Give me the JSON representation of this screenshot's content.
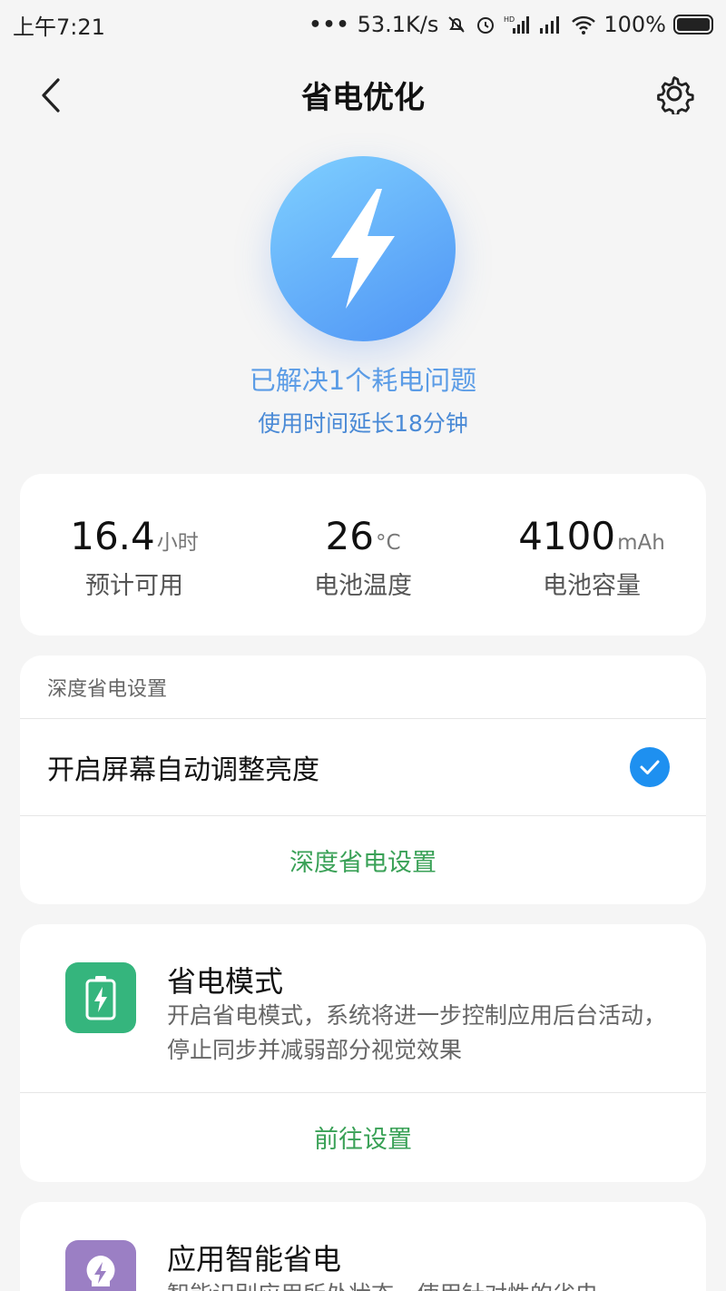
{
  "status_bar": {
    "time": "上午7:21",
    "dots": "•••",
    "net_speed": "53.1K/s",
    "battery_percent": "100%",
    "icons": [
      "mute-bell-icon",
      "alarm-icon",
      "hd-signal-icon",
      "signal-icon",
      "wifi-icon",
      "battery-icon"
    ]
  },
  "header": {
    "title": "省电优化",
    "back_icon": "back-chevron-icon",
    "settings_icon": "gear-icon"
  },
  "hero": {
    "icon": "lightning-bolt-icon",
    "title": "已解决1个耗电问题",
    "subtitle": "使用时间延长18分钟",
    "accent": "#5b9ce6"
  },
  "stats": [
    {
      "value": "16.4",
      "unit": "小时",
      "label": "预计可用"
    },
    {
      "value": "26",
      "unit": "°C",
      "label": "电池温度"
    },
    {
      "value": "4100",
      "unit": "mAh",
      "label": "电池容量"
    }
  ],
  "deep_saving": {
    "header": "深度省电设置",
    "auto_brightness_label": "开启屏幕自动调整亮度",
    "auto_brightness_checked": true,
    "link": "深度省电设置"
  },
  "power_mode": {
    "icon": "battery-bolt-icon",
    "title": "省电模式",
    "description": "开启省电模式，系统将进一步控制应用后台活动，停止同步并减弱部分视觉效果",
    "link": "前往设置",
    "icon_color": "#35b57d"
  },
  "smart_saving": {
    "icon": "bulb-bolt-icon",
    "title": "应用智能省电",
    "description": "智能识别应用所处状态，使用针对性的省电",
    "icon_color": "#9b7fc4"
  },
  "colors": {
    "link_green": "#3aa157",
    "check_blue": "#1e90f0",
    "background": "#f5f5f5"
  }
}
